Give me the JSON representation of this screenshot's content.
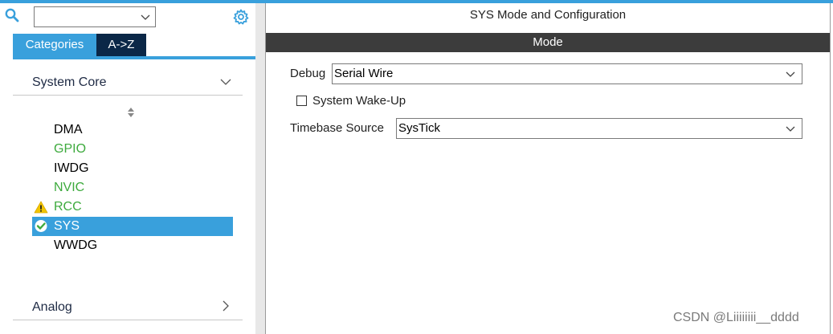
{
  "left_panel": {
    "search": {
      "value": "",
      "placeholder": ""
    },
    "tabs": [
      {
        "label": "Categories",
        "active": true
      },
      {
        "label": "A->Z",
        "active": false
      }
    ],
    "category": {
      "label": "System Core",
      "expanded": true
    },
    "peripherals": [
      {
        "label": "DMA",
        "state": "normal"
      },
      {
        "label": "GPIO",
        "state": "configured"
      },
      {
        "label": "IWDG",
        "state": "normal"
      },
      {
        "label": "NVIC",
        "state": "configured"
      },
      {
        "label": "RCC",
        "state": "warning",
        "icon": "warning-icon"
      },
      {
        "label": "SYS",
        "state": "selected",
        "icon": "check-circle-icon"
      },
      {
        "label": "WWDG",
        "state": "normal"
      }
    ],
    "analog": {
      "label": "Analog",
      "expanded": false
    }
  },
  "right_panel": {
    "title": "SYS Mode and Configuration",
    "mode_bar": "Mode",
    "debug": {
      "label": "Debug",
      "value": "Serial Wire"
    },
    "wakeup": {
      "label": "System Wake-Up",
      "checked": false
    },
    "timebase": {
      "label": "Timebase Source",
      "value": "SysTick"
    }
  },
  "watermark": "CSDN @Liiiiiiii__dddd",
  "colors": {
    "accent": "#39a0dc",
    "tab_dark": "#0b2747",
    "configured_green": "#3daa3d",
    "warning": "#f2c500",
    "mode_bar": "#3c3c3c"
  }
}
